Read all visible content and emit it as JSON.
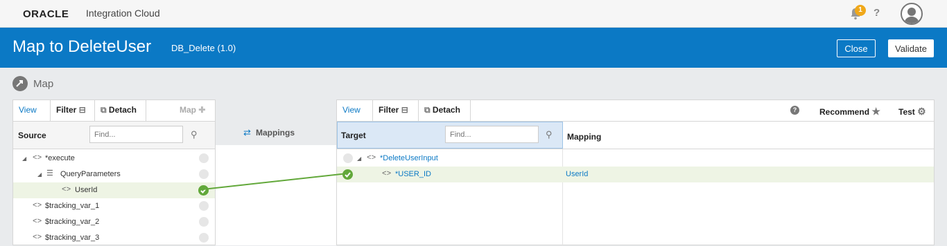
{
  "topbar": {
    "logo": "ORACLE",
    "product": "Integration Cloud",
    "notification_count": "1",
    "help": "?"
  },
  "header": {
    "title": "Map to DeleteUser",
    "subtitle": "DB_Delete (1.0)",
    "close_label": "Close",
    "validate_label": "Validate"
  },
  "breadcrumb": {
    "label": "Map"
  },
  "source": {
    "toolbar": {
      "view": "View",
      "filter": "Filter",
      "detach": "Detach",
      "map": "Map"
    },
    "header": "Source",
    "find_placeholder": "Find...",
    "rows": [
      "*execute",
      "QueryParameters",
      "UserId",
      "$tracking_var_1",
      "$tracking_var_2",
      "$tracking_var_3"
    ]
  },
  "middle": {
    "label": "Mappings"
  },
  "target": {
    "toolbar": {
      "view": "View",
      "filter": "Filter",
      "detach": "Detach",
      "recommend": "Recommend",
      "test": "Test"
    },
    "header": "Target",
    "mapping_header": "Mapping",
    "find_placeholder": "Find...",
    "rows": [
      {
        "name": "*DeleteUserInput",
        "mapping": ""
      },
      {
        "name": "*USER_ID",
        "mapping": "UserId"
      }
    ]
  },
  "colors": {
    "accent": "#0b79c5",
    "mapped": "#62a83a",
    "badge": "#f0a81a"
  }
}
